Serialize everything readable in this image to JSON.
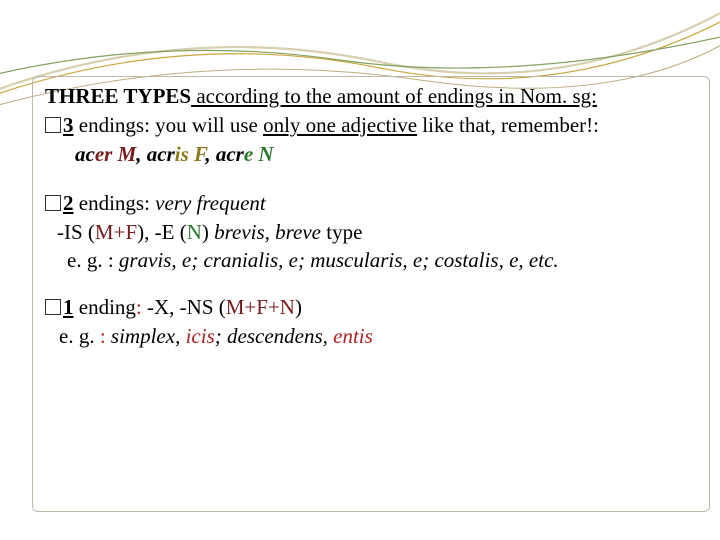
{
  "heading": {
    "strong": "THREE TYPES",
    "rest": " according to the amount of endings in Nom. sg:"
  },
  "section3": {
    "count": "3",
    "text1": "  endings: you will use ",
    "only_one_adjective": "only one adjective",
    "text2": " like that, remember!:",
    "acer_ac": "ac",
    "acer_er": "er",
    "M": " M",
    "sep1": ", ",
    "acris_acr": "acr",
    "acris_is": "is",
    "F": " F",
    "sep2": ", ",
    "acre_acr": "acr",
    "acre_e": "e",
    "N": " N"
  },
  "section2": {
    "count": "2",
    "text1": "  endings: ",
    "very_frequent": "very frequent",
    "is_label": " -IS (",
    "mf": "M+F",
    "is_close": "), -E (",
    "n": "N",
    "paren_close": ") ",
    "brevis_breve": "brevis, breve",
    "type_word": " type",
    "eg_lead": "e. g. : ",
    "examples": "gravis, e; cranialis, e; muscularis, e; costalis, e, etc."
  },
  "section1": {
    "count": "1",
    "text1": "  ending",
    "colon": ": ",
    "xns": "-X, -NS",
    "paren_open": " (",
    "mfn": "M+F+N",
    "paren_close": ")",
    "eg_lead": "e. g. ",
    "eg_colon": ": ",
    "simplex": "simplex, ",
    "icis": "icis",
    "sep": "; ",
    "descendens": "descendens, ",
    "entis": "entis"
  }
}
